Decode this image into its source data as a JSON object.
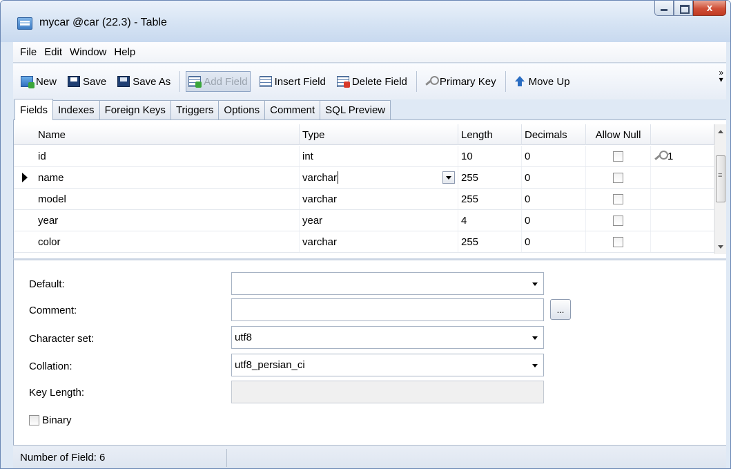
{
  "window": {
    "title": "mycar @car (22.3) - Table",
    "close_glyph": "x"
  },
  "menu": [
    "File",
    "Edit",
    "Window",
    "Help"
  ],
  "toolbar": {
    "new": "New",
    "save": "Save",
    "save_as": "Save As",
    "add_field": "Add Field",
    "insert_field": "Insert Field",
    "delete_field": "Delete Field",
    "primary_key": "Primary Key",
    "move_up": "Move Up",
    "overflow": "»"
  },
  "tabs": [
    "Fields",
    "Indexes",
    "Foreign Keys",
    "Triggers",
    "Options",
    "Comment",
    "SQL Preview"
  ],
  "grid": {
    "headers": [
      "Name",
      "Type",
      "Length",
      "Decimals",
      "Allow Null"
    ],
    "rows": [
      {
        "name": "id",
        "type": "int",
        "length": "10",
        "decimals": "0",
        "allow_null": false,
        "key": "1"
      },
      {
        "name": "name",
        "type": "varchar",
        "length": "255",
        "decimals": "0",
        "allow_null": false,
        "key": ""
      },
      {
        "name": "model",
        "type": "varchar",
        "length": "255",
        "decimals": "0",
        "allow_null": false,
        "key": ""
      },
      {
        "name": "year",
        "type": "year",
        "length": "4",
        "decimals": "0",
        "allow_null": false,
        "key": ""
      },
      {
        "name": "color",
        "type": "varchar",
        "length": "255",
        "decimals": "0",
        "allow_null": false,
        "key": ""
      }
    ]
  },
  "props": {
    "default_label": "Default:",
    "default_value": "",
    "comment_label": "Comment:",
    "comment_value": "",
    "comment_button": "...",
    "charset_label": "Character set:",
    "charset_value": "utf8",
    "collation_label": "Collation:",
    "collation_value": "utf8_persian_ci",
    "key_length_label": "Key Length:",
    "key_length_value": "",
    "binary_label": "Binary"
  },
  "status": {
    "text": "Number of Field: 6"
  }
}
